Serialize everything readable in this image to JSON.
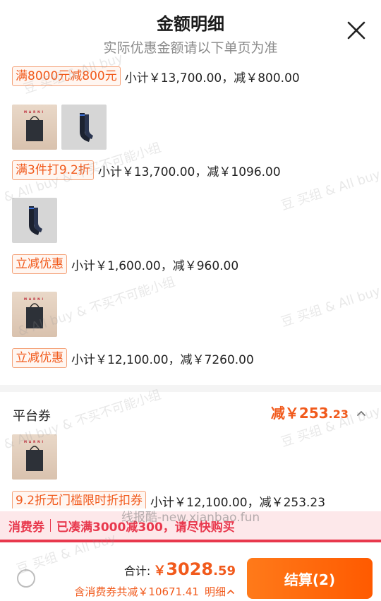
{
  "header": {
    "title": "金额明细",
    "subtitle": "实际优惠金额请以下单页为准"
  },
  "promotions": [
    {
      "tag": "满8000元减800元",
      "text": "小计￥13,700.00，减￥800.00"
    },
    {
      "tag": "满3件打9.2折",
      "text": "小计￥13,700.00，减￥1096.00"
    },
    {
      "tag": "立减优惠",
      "text": "小计￥1,600.00，减￥960.00"
    },
    {
      "tag": "立减优惠",
      "text": "小计￥12,100.00，减￥7260.00"
    }
  ],
  "product_brand": "MARNI",
  "platform_coupon": {
    "label": "平台券",
    "amount_prefix": "减￥",
    "amount_int": "253",
    "amount_dec": ".23",
    "promo": {
      "tag": "9.2折无门槛限时折扣券",
      "text": "小计￥12,100.00，减￥253.23"
    }
  },
  "notice": {
    "tag": "消费券",
    "message": "已凑满3000减300，请尽快购买"
  },
  "watermark_url": "线报酷-new.xianbao.fun",
  "footer": {
    "total_label": "合计:",
    "currency": "￥",
    "total_int": "3028",
    "total_dec": ".59",
    "discount_text": "含消费券共减￥10671.41",
    "detail_label": "明细",
    "pay_label": "结算(2)"
  },
  "watermarks": {
    "text_cn": "豆 买组 & All buy",
    "text_mixed": "& All buy & 不买不可能小组"
  },
  "colors": {
    "accent": "#f15a1c",
    "notice_red": "#e8384d",
    "pay_button": "#ff6a0a"
  },
  "icons": {
    "close": "close-icon",
    "chevron_up": "chevron-up-icon",
    "radio": "radio-unchecked-icon"
  }
}
